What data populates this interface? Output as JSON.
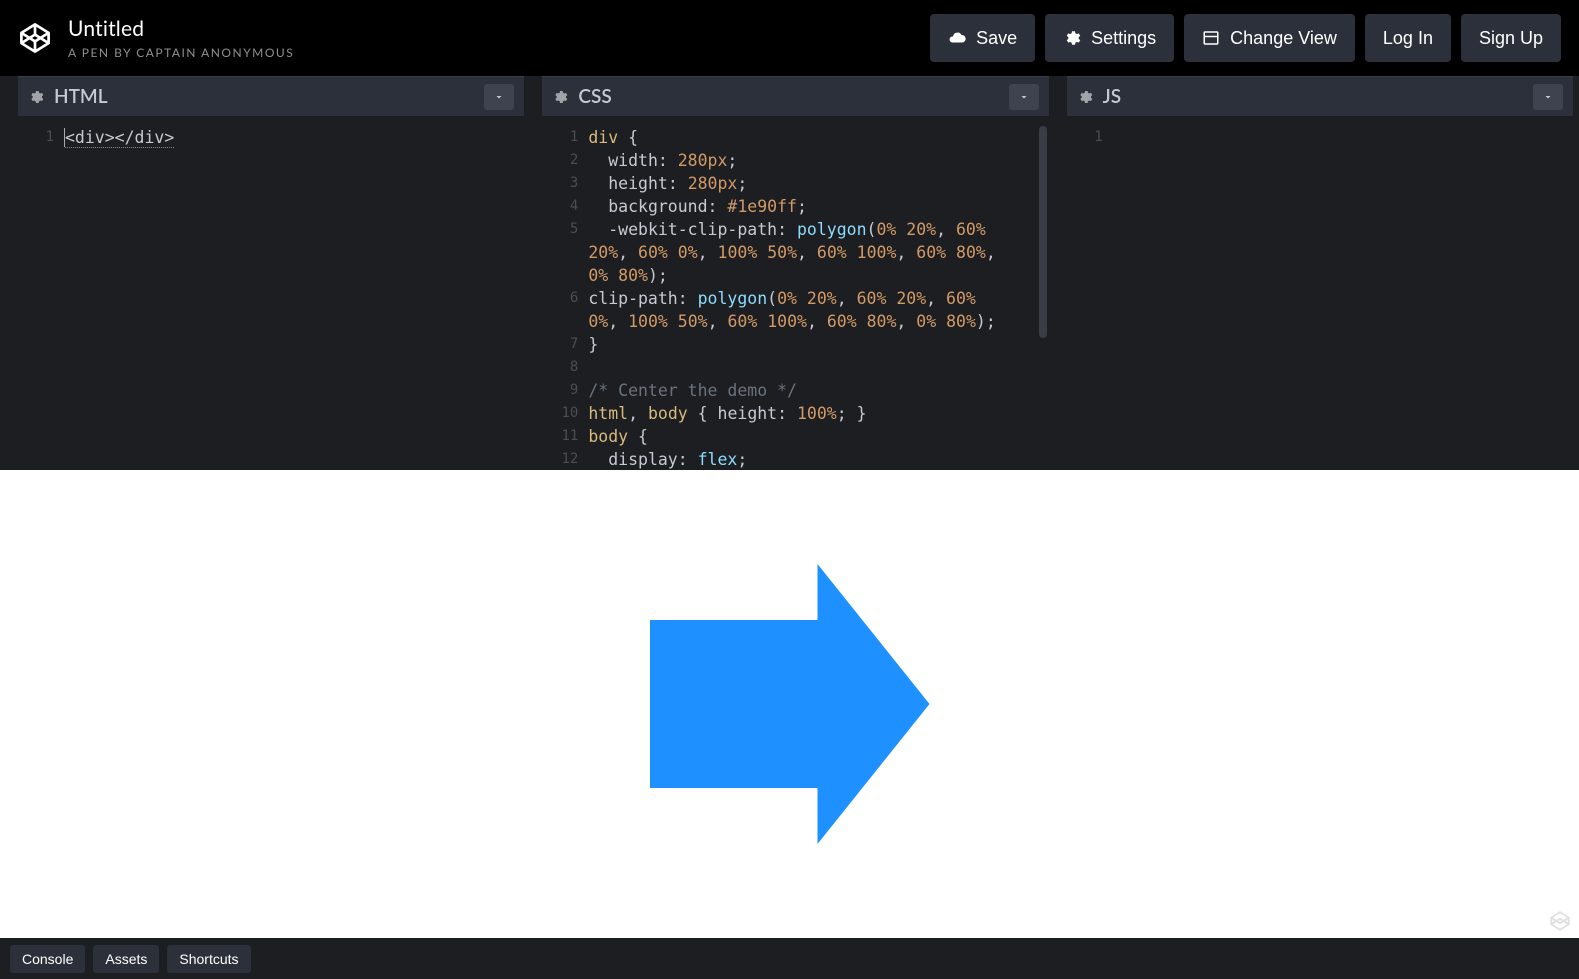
{
  "header": {
    "title": "Untitled",
    "byline": "A PEN BY CAPTAIN ANONYMOUS",
    "actions": {
      "save": "Save",
      "settings": "Settings",
      "change_view": "Change View",
      "login": "Log In",
      "signup": "Sign Up"
    }
  },
  "panels": {
    "html": {
      "title": "HTML"
    },
    "css": {
      "title": "CSS"
    },
    "js": {
      "title": "JS"
    }
  },
  "code": {
    "html": {
      "line1": "<div></div>"
    },
    "css": {
      "l1": "div {",
      "l2": "  width: 280px;",
      "l3": "  height: 280px;",
      "l4": "  background: #1e90ff;",
      "l5a": "  -webkit-clip-path: polygon(0% 20%, 60%",
      "l5b": "20%, 60% 0%, 100% 50%, 60% 100%, 60% 80%,",
      "l5c": "0% 80%);",
      "l6a": "clip-path: polygon(0% 20%, 60% 20%, 60%",
      "l6b": "0%, 100% 50%, 60% 100%, 60% 80%, 0% 80%);",
      "l7": "}",
      "l8": "",
      "l9": "/* Center the demo */",
      "l10": "html, body { height: 100%; }",
      "l11": "body {",
      "l12": "  display: flex;"
    }
  },
  "preview": {
    "shape_color": "#1e90ff",
    "shape_width": 280,
    "shape_height": 280,
    "clip_path": "polygon(0% 20%, 60% 20%, 60% 0%, 100% 50%, 60% 100%, 60% 80%, 0% 80%)"
  },
  "footer": {
    "console": "Console",
    "assets": "Assets",
    "shortcuts": "Shortcuts"
  }
}
